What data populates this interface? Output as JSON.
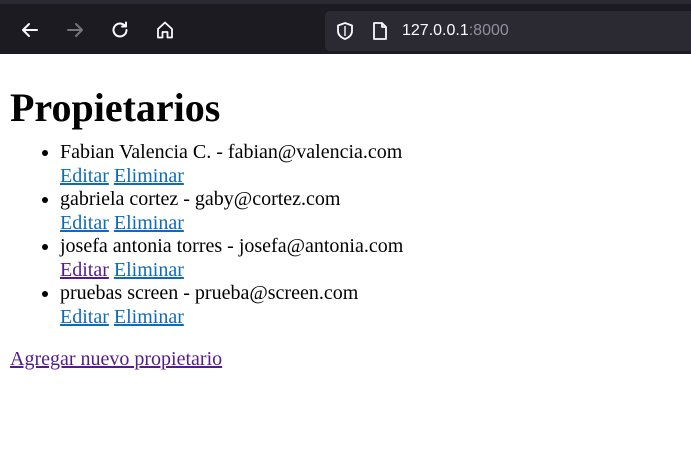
{
  "browser": {
    "url_host": "127.0.0.1",
    "url_port": ":8000"
  },
  "page": {
    "title": "Propietarios",
    "owners": [
      {
        "text": "Fabian Valencia C. - fabian@valencia.com",
        "edit": "Editar",
        "delete": "Eliminar"
      },
      {
        "text": "gabriela cortez - gaby@cortez.com",
        "edit": "Editar",
        "delete": "Eliminar"
      },
      {
        "text": "josefa antonia torres - josefa@antonia.com",
        "edit": "Editar",
        "delete": "Eliminar"
      },
      {
        "text": "pruebas screen - prueba@screen.com",
        "edit": "Editar",
        "delete": "Eliminar"
      }
    ],
    "add_link": "Agregar nuevo propietario"
  },
  "colors": {
    "toolbar_bg": "#1c1b22",
    "urlbar_bg": "#2b2a33",
    "link": "#0e6bb7",
    "visited_link": "#551a8b"
  },
  "icons": [
    "back-arrow-icon",
    "forward-arrow-icon",
    "reload-icon",
    "home-icon",
    "shield-icon",
    "page-icon"
  ]
}
